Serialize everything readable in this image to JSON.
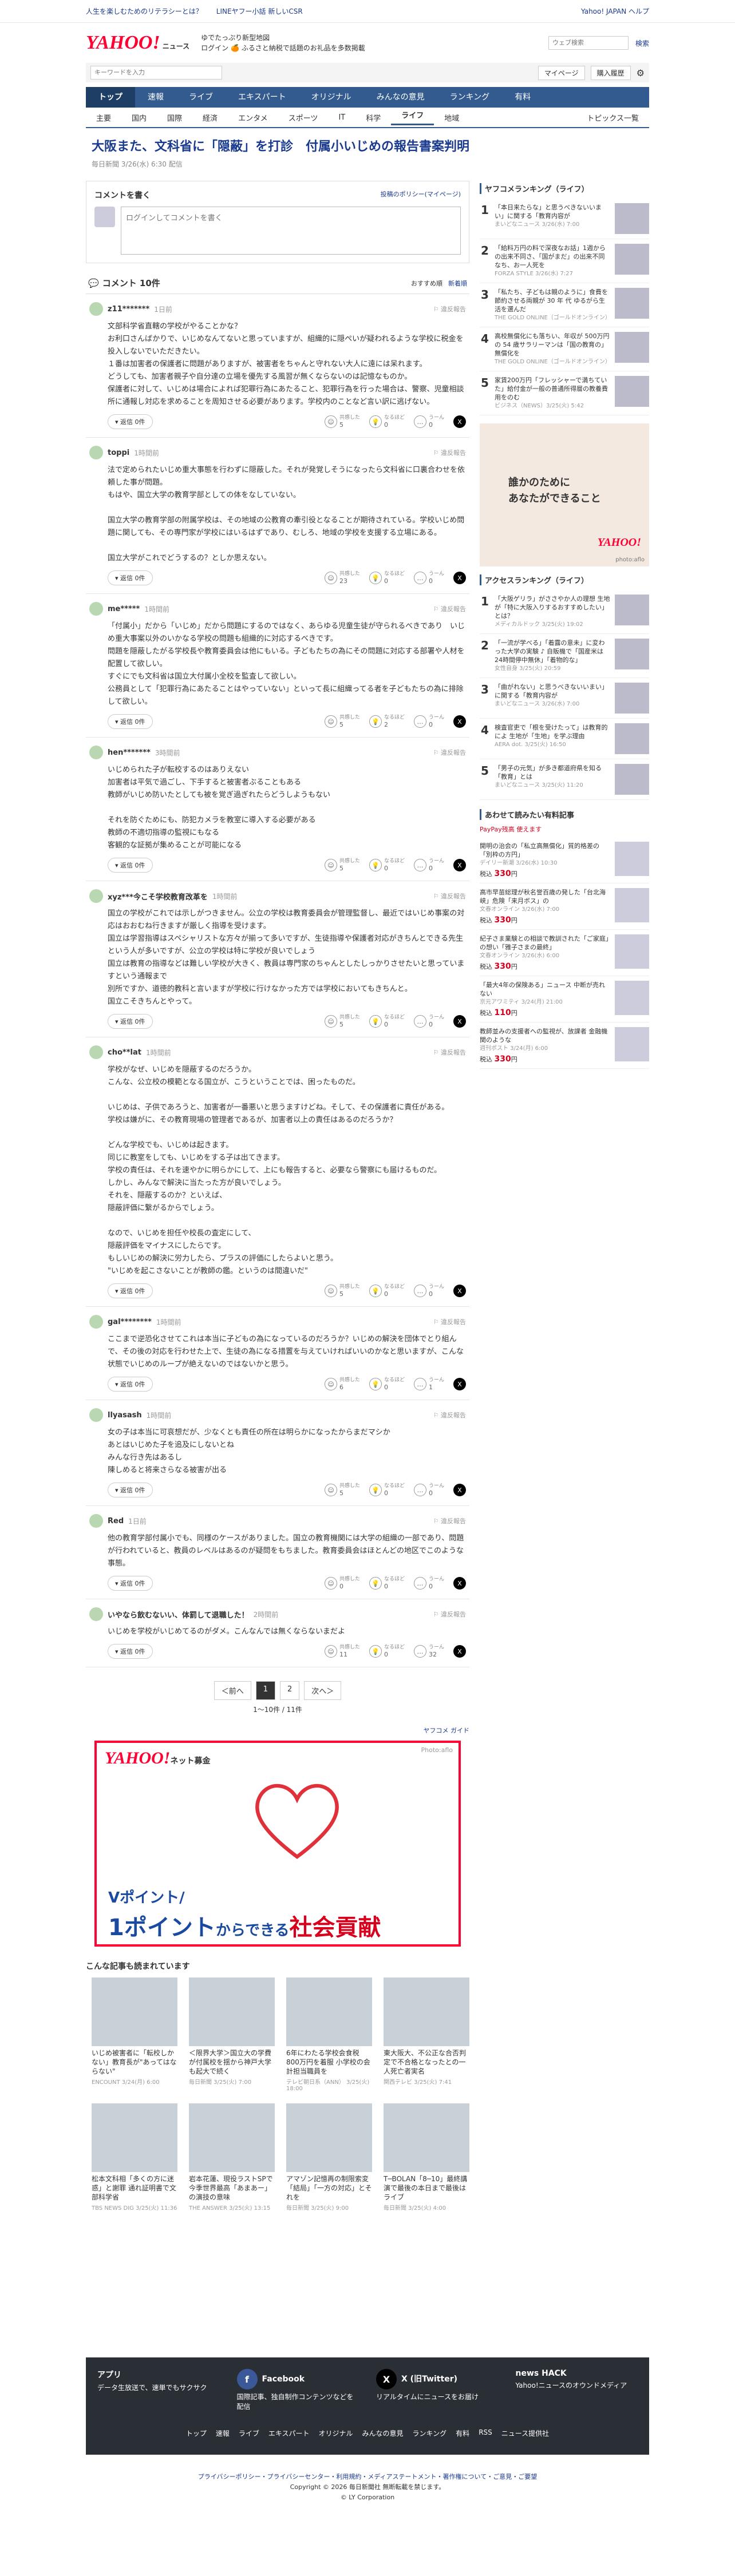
{
  "topbar": {
    "left1": "人生を楽しむためのリテラシーとは？",
    "left2": "LINEヤフー小話 新しいCSR",
    "right1": "Yahoo! JAPAN ヘルプ"
  },
  "header": {
    "logo": "YAHOO!",
    "logo_sub": "ニュース",
    "promo1": "ゆでたっぷり新型地図",
    "promo2": "ログイン 🍊 ふるさと納税で話題のお礼品を多数掲載",
    "search_placeholder": "ウェブ検索",
    "search_btn": "検索"
  },
  "searchbar": {
    "placeholder": "キーワードを入力",
    "mypage": "マイページ",
    "login": "購入履歴"
  },
  "gnav": [
    "トップ",
    "速報",
    "ライブ",
    "エキスパート",
    "オリジナル",
    "みんなの意見",
    "ランキング",
    "有料"
  ],
  "snav": [
    "主要",
    "国内",
    "国際",
    "経済",
    "エンタメ",
    "スポーツ",
    "IT",
    "科学",
    "ライフ",
    "地域"
  ],
  "snav_right": "トピックス一覧",
  "article": {
    "title": "大阪また、文科省に「隠蔽」を打診　付属小いじめの報告書案判明",
    "meta": "毎日新聞 3/26(水) 6:30 配信"
  },
  "comment_form": {
    "heading": "コメントを書く",
    "policy": "投稿のポリシー(マイページ)",
    "placeholder": "ログインしてコメントを書く"
  },
  "comments_head": {
    "title": "コメント 10件",
    "sort1": "おすすめ順",
    "sort2": "新着順"
  },
  "labels": {
    "reply": "返信 0件",
    "report": "違反報告",
    "agree": "共感した",
    "insight": "なるほど",
    "question": "うーん"
  },
  "comments": [
    {
      "user": "z11*******",
      "time": "1日前",
      "body": "文部科学省直轄の学校がやることかな？\nお利口さんばかりで、いじめなんてないと思っていますが、組織的に隠ぺいが疑われるような学校に税金を投入しないでいただきたい。\n１番は加害者の保護者に問題がありますが、被害者をちゃんと守れない大人に遠には呆れます。\nどうしても、加害者親子や自分達の立場を優先する風習が無くならないのは記憶なものか。\n保護者に対して、いじめは場合によれば犯罪行為にあたること、犯罪行為を行った場合は、警察、児童相談所に通報し対応を求めることを周知させる必要があります。学校内のことなど言い訳に逃げない。",
      "a": "5",
      "b": "0",
      "c": "0"
    },
    {
      "user": "toppi",
      "time": "1時間前",
      "body": "法で定められたいじめ重大事態を行わずに隠蔽した。それが発覚しそうになったら文科省に口裏合わせを依頼した事が問題。\nもはや、国立大学の教育学部としての体をなしていない。\n\n国立大学の教育学部の附属学校は、その地域の公教育の牽引役となることが期待されている。学校いじめ問題に関しても、その専門家が学校にはいるはずであり、むしろ、地域の学校を支援する立場にある。\n\n国立大学がこれでどうするの？としか思えない。",
      "a": "23",
      "b": "0",
      "c": "0"
    },
    {
      "user": "me*****",
      "time": "1時間前",
      "body": "「付属小」だから「いじめ」だから問題にするのではなく、あらゆる児童生徒が守られるべきであり　いじめ重大事案以外のいかなる学校の問題も組織的に対応するべきです。\n問題を隠蔽したがる学校長や教育委員会は他にもいる。子どもたちの為にその問題に対応する部署や人材を配置して欲しい。\nすぐにでも文科省は国立大付属小全校を監査して欲しい。\n公務員として「犯罪行為にあたることはやっていない」といって長に組織ってる者を子どもたちの為に排除して欲しい。",
      "a": "5",
      "b": "2",
      "c": "0"
    },
    {
      "user": "hen*******",
      "time": "3時間前",
      "body": "いじめられた子が転校するのはありえない\n加害者は平気で過ごし、下手すると被害者ぶることもある\n教師がいじめ防いたとしても被を覚ぎ過ぎれたらどうしようもない\n\nそれを防ぐためにも、防犯カメラを教室に導入する必要がある\n教師の不適切指導の監視にもなる\n客観的な証拠が集めることが可能になる",
      "a": "5",
      "b": "0",
      "c": "0"
    },
    {
      "user": "xyz***今こそ学校教育改革を",
      "time": "1時間前",
      "body": "国立の学校がこれでは示しがつきません。公立の学校は教育委員会が管理監督し、最近ではいじめ事案の対応はおおむね行きますが厳しく指導を受けます。\n国立は学習指導はスペシャリストな方々が揃って多いですが、生徒指導や保護者対応がきちんとできる先生という人が多いですが、公立の学校は特に学校が良いでしょう\n国立は教育の指導などは難しい学校が大きく、教員は専門家のちゃんとしたしっかりさせたいと思っていますという通報まで\n別所ですか、道徳的教科と言いますが学校に行けなかった方では学校においてもきちんと。\n国立こそきちんとやって。",
      "a": "5",
      "b": "0",
      "c": "0"
    },
    {
      "user": "cho**lat",
      "time": "1時間前",
      "body": "学校がなぜ、いじめを隠蔽するのだろうか。\nこんな、公立校の模範となる国立が、こうということでは、困ったものだ。\n\nいじめは、子供であろうと、加害者が一番悪いと思うますけどね。そして、その保護者に責任がある。\n学校は嫌がに、その教育現場の管理者であるが、加害者以上の責任はあるのだろうか？\n\nどんな学校でも、いじめは起きます。\n同じに教室をしても、いじめをする子は出てきます。\n学校の責任は、それを速やかに明らかにして、上にも報告すると、必要なら警察にも届けるものだ。\nしかし、みんなで解決に当たった方が良いでしょう。\nそれを、隠蔽するのか？といえば、\n隠蔽評価に繋がるからでしょう。\n\nなので、いじめを担任や校長の査定にして、\n隠蔽評価をマイナスにしたらです。\nもしいじめの解決に労力したら、プラスの評価にしたらよいと思う。\n\"いじめを起こさないことが教師の鑑。というのは間違いだ\"",
      "a": "5",
      "b": "0",
      "c": "0"
    },
    {
      "user": "gal********",
      "time": "1時間前",
      "body": "ここまで逆恐化させてこれは本当に子どもの為になっているのだろうか？いじめの解決を団体でとり組んで、その後の対応を行わせた上で、生徒の為になる措置を与えていければいいのかなと思いますが、こんな状態でいじめのループが絶えないのではないかと思う。",
      "a": "6",
      "b": "0",
      "c": "1"
    },
    {
      "user": "llyasash",
      "time": "1時間前",
      "body": "女の子は本当に可哀想だが、少なくとも責任の所在は明らかになったからまだマシか\nあとはいじめた子を追及にしないとね\nみんな行き先はあるし\n陳しめると将来さらなる被害が出る",
      "a": "5",
      "b": "0",
      "c": "0"
    },
    {
      "user": "Red",
      "time": "1日前",
      "body": "他の教育学部付属小でも、同様のケースがありました。国立の教育機関には大学の組織の一部であり、問題が行われていると、教員のレベルはあるのが疑問をもちました。教育委員会はほとんどの地区でこのような事態。",
      "a": "0",
      "b": "0",
      "c": "0"
    },
    {
      "user": "いやなら飲むないい、体罰して退職した！",
      "time": "2時間前",
      "body": "いじめを学校がいじめてるのがダメ。こんなんでは無くならないまだよ",
      "a": "11",
      "b": "0",
      "c": "32"
    }
  ],
  "pager": {
    "prev": "＜前へ",
    "p1": "1",
    "p2": "2",
    "next": "次へ＞",
    "summary": "1〜10件 / 11件"
  },
  "note": "ヤフコメ ガイド",
  "banner": {
    "logo": "YAHOO!",
    "logo_sub": "ネット募金",
    "photo": "Photo:aflo",
    "t1": "Vポイント/",
    "t2a": "1ポイント",
    "t2b": "からできる",
    "t2c": "社会貢献"
  },
  "recs_title": "こんな記事も読まれています",
  "recs": [
    {
      "title": "いじめ被害者に「転校しかない」教育長が\"あってはならない\"",
      "src": "ENCOUNT 3/24(月) 6:00"
    },
    {
      "title": "＜限界大学＞国立大の学費が付属校を揺から神戸大学も起大で続く",
      "src": "毎日新聞 3/25(火) 7:00"
    },
    {
      "title": "6年にわたる学校会食税800万円を着服 小学校の会計担当職員を",
      "src": "テレビ朝日系（ANN） 3/25(火) 18:00"
    },
    {
      "title": "東大阪大、不公正な合否判定で不合格となったとの一人死亡者実名",
      "src": "関西テレビ 3/25(火) 7:41"
    },
    {
      "title": "松本文科相「多くの方に迷惑」と謝罪 通れ証明書で文部科学省",
      "src": "TBS NEWS DIG 3/25(火) 11:36"
    },
    {
      "title": "岩本花蓮、現役ラストSPで今季世界最高「あまあー」の演技の意味",
      "src": "THE ANSWER 3/25(火) 13:15"
    },
    {
      "title": "アマゾン記憶再の制限索変「結局」「一方の対応」とそれを",
      "src": "毎日新聞 3/25(火) 9:00"
    },
    {
      "title": "T─BOLAN「8─10」最終講演で最後の本日まで最後はライブ",
      "src": "毎日新聞 3/25(火) 4:00"
    }
  ],
  "side": {
    "rank_title": "ヤフコメランキング（ライフ）",
    "rank": [
      {
        "n": "1",
        "t": "「本日来たらな」と思うべきないいまい」に関する「教育内容が",
        "s": "まいどなニュース 3/26(水) 7:00"
      },
      {
        "n": "2",
        "t": "「給料万円の料で深夜なお話」1週から の出来不同さ、「国がまだ」の出来不同なち、お一人死を",
        "s": "FORZA STYLE 3/26(水) 7:27"
      },
      {
        "n": "3",
        "t": "「私たち、子どもは親のように」食費を節約させる両親が 30 年 代 ゆるがら生活を選んだ",
        "s": "THE GOLD ONLINE（ゴールドオンライン）"
      },
      {
        "n": "4",
        "t": "高校無償化にも落ちい、年収が 500万円 の 54 歳サラリーマンは「国の教育の」無償化を",
        "s": "THE GOLD ONLINE（ゴールドオンライン）"
      },
      {
        "n": "5",
        "t": "家賃200万円「フレッシャーで満ちていた」給付金が一般の普通所得層の教養費用をのむ",
        "s": "ビジネス（NEWS）3/25(火) 5:42"
      }
    ],
    "ad_text1": "誰かのために",
    "ad_text2": "あなたができること",
    "ad_logo": "YAHOO!",
    "ad_photo": "photo:aflo",
    "access_title": "アクセスランキング（ライフ）",
    "access": [
      {
        "n": "1",
        "t": "「大阪ゲリラ」がささやか人の理想 生地が「特に大阪入りするおすすめしたい」とは？",
        "s": "メディカルドック 3/25(火) 19:02"
      },
      {
        "n": "2",
        "t": "「一流が学べる」「着露の意未」に変わった大学の実験 ♪ 自販機で「国産米は24時間停中無休」「着物的な」",
        "s": "女性自身 3/25(火) 20:59"
      },
      {
        "n": "3",
        "t": "「曲がれない」と思うべきないいまい」に関する「教育内容が",
        "s": "まいどなニュース 3/26(水) 7:00"
      },
      {
        "n": "4",
        "t": "検査官吏で「根を受けたって」は教育的によ 生地が「生地」を学ぶ理由",
        "s": "AERA dot. 3/25(火) 16:50"
      },
      {
        "n": "5",
        "t": "「男子の元気」が多き都道府県を知る「教育」とは",
        "s": "まいどなニュース 3/25(火) 11:20"
      }
    ],
    "paid_title": "あわせて読みたい有料記事",
    "paid_sub": "PayPay残高 使えます",
    "paid": [
      {
        "t": "開明の治会の「私立高無償化」質的格差の「別枠の方円」",
        "s": "デイリー新潮 3/26(水) 10:30",
        "p": "330"
      },
      {
        "t": "高市早苗総理が秋名誉百歳の発した「台北海峡」危険「来月ボス」の",
        "s": "文春オンライン 3/26(水) 7:00",
        "p": "330"
      },
      {
        "t": "紀子さま業験との相談で教訓された「ご家庭」の想い「雅子さまの最終」",
        "s": "文春オンライン 3/26(水) 6:00",
        "p": "330"
      },
      {
        "t": "「最大4年の保険ある」ニュース 中断が売れない",
        "s": "京元アワミティ 3/24(月) 21:00",
        "p": "110"
      },
      {
        "t": "教師並みの支援者への監視が、放課者 金融機関のような",
        "s": "週刊ポスト 3/24(月) 6:00",
        "p": "330"
      }
    ],
    "price_unit": "税込"
  },
  "footer": {
    "app": "アプリ",
    "app_d": "データ生放送で、速単でもサクサク",
    "fb": "Facebook",
    "fb_d": "国際記事、独自制作コンテンツなどを配信",
    "x": "X (旧Twitter)",
    "x_d": "リアルタイムにニュースをお届け",
    "hack": "news HACK",
    "hack_d": "Yahoo!ニュースのオウンドメディア",
    "links": [
      "トップ",
      "速報",
      "ライブ",
      "エキスパート",
      "オリジナル",
      "みんなの意見",
      "ランキング",
      "有料",
      "RSS",
      "ニュース提供社"
    ],
    "legal1": "プライバシーポリシー・プライバシーセンター・利用規約・メディアステートメント・著作権について・ご意見・ご要望",
    "copy": "Copyright © 2026 毎日新聞社 無断転載を禁じます。",
    "corp": "© LY Corporation"
  }
}
